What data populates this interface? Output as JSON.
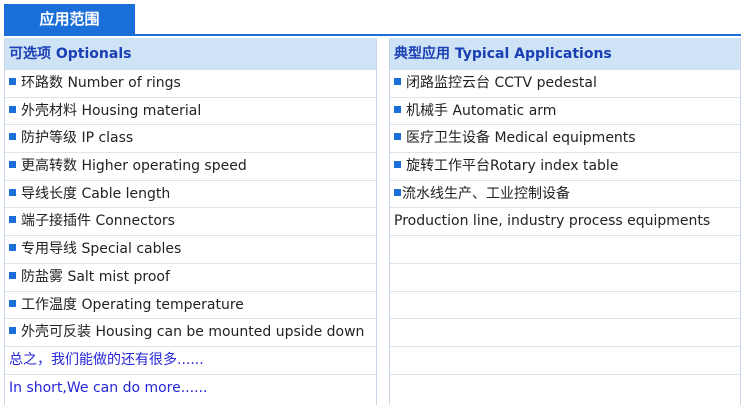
{
  "tab": {
    "label": "应用范围"
  },
  "left": {
    "header": "可选项 Optionals",
    "items": [
      "环路数 Number of rings",
      "外壳材料 Housing material",
      "防护等级 IP class",
      "更高转数 Higher operating speed",
      "导线长度 Cable length",
      "端子接插件 Connectors",
      "专用导线 Special cables",
      "防盐雾 Salt mist proof",
      "工作温度 Operating temperature",
      "外壳可反装 Housing can be mounted upside down"
    ],
    "note_cn": "总之，我们能做的还有很多......",
    "note_en": "In short,We can do more......"
  },
  "right": {
    "header": "典型应用 Typical Applications",
    "items": [
      "闭路监控云台 CCTV pedestal",
      "机械手 Automatic arm",
      "医疗卫生设备 Medical equipments",
      "旋转工作平台Rotary index table",
      "流水线生产、工业控制设备"
    ],
    "continuation": "Production line, industry process equipments"
  },
  "colors": {
    "accent": "#1b6fd8",
    "header_bg": "#cfe3f6",
    "header_text": "#1a3fb3",
    "note_text": "#2626d9"
  }
}
